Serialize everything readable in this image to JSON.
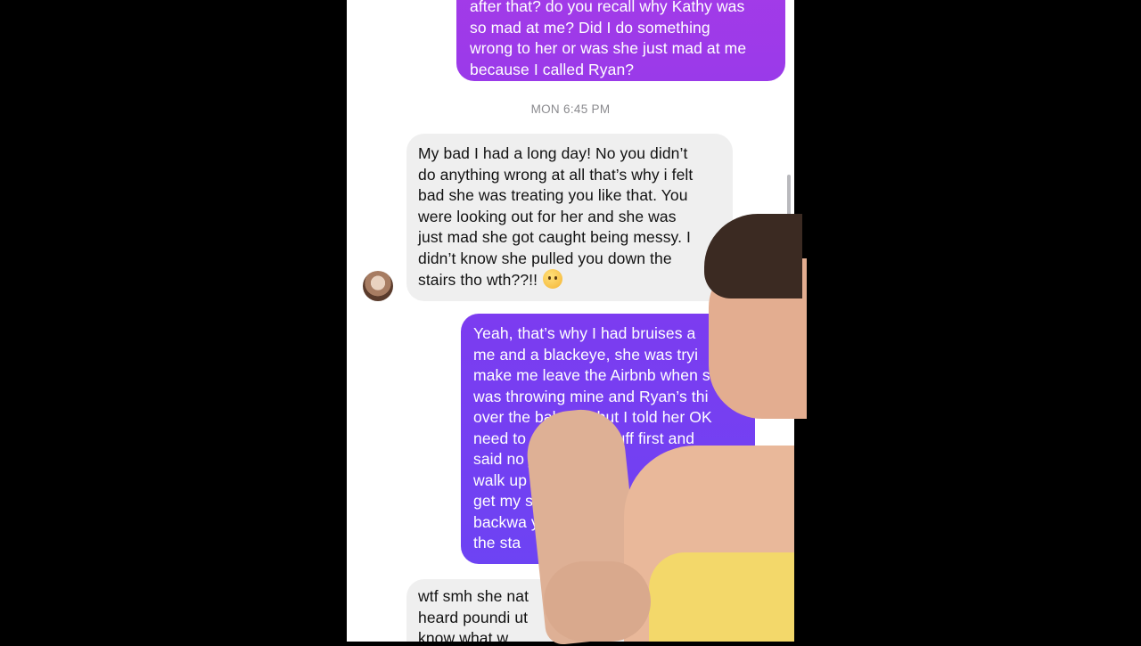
{
  "conversation": {
    "timestamp": "MON 6:45 PM",
    "outgoing_1": [
      "after that? do you recall why Kathy was",
      "so mad at me? Did I do something",
      "wrong to her or was she just mad at me",
      "because I called Ryan?"
    ],
    "incoming_1": [
      "My bad I had a long day! No you didn’t",
      "do anything wrong at all that’s why i felt",
      "bad she was treating you like that. You",
      "were looking out for her and she was",
      "just mad she got caught being messy. I",
      "didn’t know she pulled you down the",
      "stairs tho wth??!!"
    ],
    "outgoing_2": [
      "Yeah, that’s why I had bruises a",
      "me and a blackeye, she was tryi",
      "make me leave the Airbnb when s",
      "was throwing mine and Ryan’s thi",
      "over the balcony, but I told her OK",
      "need to go get my stuff first and",
      "said no ju   et out an",
      "walk up t    stairs to",
      "get my s    and s",
      "backwa      y m",
      "the sta"
    ],
    "incoming_2": [
      "wtf smh she               nat",
      "heard poundi               ut",
      "know what w"
    ]
  },
  "icons": {
    "avatar": "contact-avatar",
    "emoji": "anxious-face-emoji"
  },
  "colors": {
    "outgoing_1": "#a43be8",
    "outgoing_2": "#7c3cf0",
    "incoming": "#efefef",
    "background": "#000000"
  }
}
